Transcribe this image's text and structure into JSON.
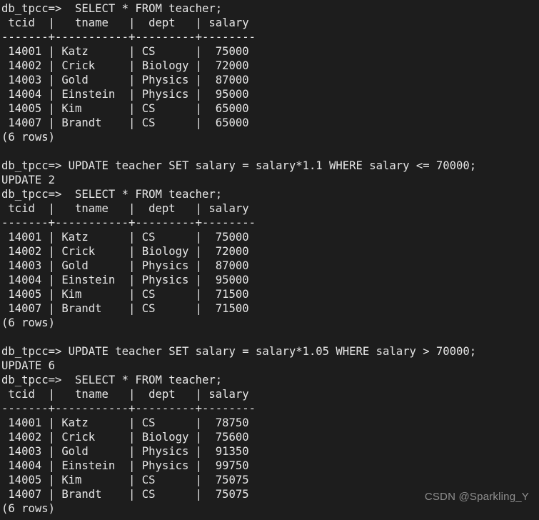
{
  "terminal": {
    "background_color": "#1d1d1d",
    "text_color": "#e6e6e6",
    "prompt": "db_tpcc=>",
    "lines": [
      "db_tpcc=>  SELECT * FROM teacher;",
      " tcid  |   tname   |  dept   | salary",
      "-------+-----------+---------+--------",
      " 14001 | Katz      | CS      |  75000",
      " 14002 | Crick     | Biology |  72000",
      " 14003 | Gold      | Physics |  87000",
      " 14004 | Einstein  | Physics |  95000",
      " 14005 | Kim       | CS      |  65000",
      " 14007 | Brandt    | CS      |  65000",
      "(6 rows)",
      "",
      "db_tpcc=> UPDATE teacher SET salary = salary*1.1 WHERE salary <= 70000;",
      "UPDATE 2",
      "db_tpcc=>  SELECT * FROM teacher;",
      " tcid  |   tname   |  dept   | salary",
      "-------+-----------+---------+--------",
      " 14001 | Katz      | CS      |  75000",
      " 14002 | Crick     | Biology |  72000",
      " 14003 | Gold      | Physics |  87000",
      " 14004 | Einstein  | Physics |  95000",
      " 14005 | Kim       | CS      |  71500",
      " 14007 | Brandt    | CS      |  71500",
      "(6 rows)",
      "",
      "db_tpcc=> UPDATE teacher SET salary = salary*1.05 WHERE salary > 70000;",
      "UPDATE 6",
      "db_tpcc=>  SELECT * FROM teacher;",
      " tcid  |   tname   |  dept   | salary",
      "-------+-----------+---------+--------",
      " 14001 | Katz      | CS      |  78750",
      " 14002 | Crick     | Biology |  75600",
      " 14003 | Gold      | Physics |  91350",
      " 14004 | Einstein  | Physics |  99750",
      " 14005 | Kim       | CS      |  75075",
      " 14007 | Brandt    | CS      |  75075",
      "(6 rows)"
    ]
  },
  "session": {
    "database": "db_tpcc",
    "table": "teacher",
    "columns": [
      "tcid",
      "tname",
      "dept",
      "salary"
    ],
    "queries": [
      {
        "command": "SELECT * FROM teacher;",
        "result_count": "(6 rows)",
        "rows": [
          {
            "tcid": "14001",
            "tname": "Katz",
            "dept": "CS",
            "salary": "75000"
          },
          {
            "tcid": "14002",
            "tname": "Crick",
            "dept": "Biology",
            "salary": "72000"
          },
          {
            "tcid": "14003",
            "tname": "Gold",
            "dept": "Physics",
            "salary": "87000"
          },
          {
            "tcid": "14004",
            "tname": "Einstein",
            "dept": "Physics",
            "salary": "95000"
          },
          {
            "tcid": "14005",
            "tname": "Kim",
            "dept": "CS",
            "salary": "65000"
          },
          {
            "tcid": "14007",
            "tname": "Brandt",
            "dept": "CS",
            "salary": "65000"
          }
        ]
      },
      {
        "command": "UPDATE teacher SET salary = salary*1.1 WHERE salary <= 70000;",
        "status": "UPDATE 2"
      },
      {
        "command": "SELECT * FROM teacher;",
        "result_count": "(6 rows)",
        "rows": [
          {
            "tcid": "14001",
            "tname": "Katz",
            "dept": "CS",
            "salary": "75000"
          },
          {
            "tcid": "14002",
            "tname": "Crick",
            "dept": "Biology",
            "salary": "72000"
          },
          {
            "tcid": "14003",
            "tname": "Gold",
            "dept": "Physics",
            "salary": "87000"
          },
          {
            "tcid": "14004",
            "tname": "Einstein",
            "dept": "Physics",
            "salary": "95000"
          },
          {
            "tcid": "14005",
            "tname": "Kim",
            "dept": "CS",
            "salary": "71500"
          },
          {
            "tcid": "14007",
            "tname": "Brandt",
            "dept": "CS",
            "salary": "71500"
          }
        ]
      },
      {
        "command": "UPDATE teacher SET salary = salary*1.05 WHERE salary > 70000;",
        "status": "UPDATE 6"
      },
      {
        "command": "SELECT * FROM teacher;",
        "result_count": "(6 rows)",
        "rows": [
          {
            "tcid": "14001",
            "tname": "Katz",
            "dept": "CS",
            "salary": "78750"
          },
          {
            "tcid": "14002",
            "tname": "Crick",
            "dept": "Biology",
            "salary": "75600"
          },
          {
            "tcid": "14003",
            "tname": "Gold",
            "dept": "Physics",
            "salary": "91350"
          },
          {
            "tcid": "14004",
            "tname": "Einstein",
            "dept": "Physics",
            "salary": "99750"
          },
          {
            "tcid": "14005",
            "tname": "Kim",
            "dept": "CS",
            "salary": "75075"
          },
          {
            "tcid": "14007",
            "tname": "Brandt",
            "dept": "CS",
            "salary": "75075"
          }
        ]
      }
    ]
  },
  "watermark": {
    "text": "CSDN @Sparkling_Y",
    "color": "#8f8f8f"
  }
}
